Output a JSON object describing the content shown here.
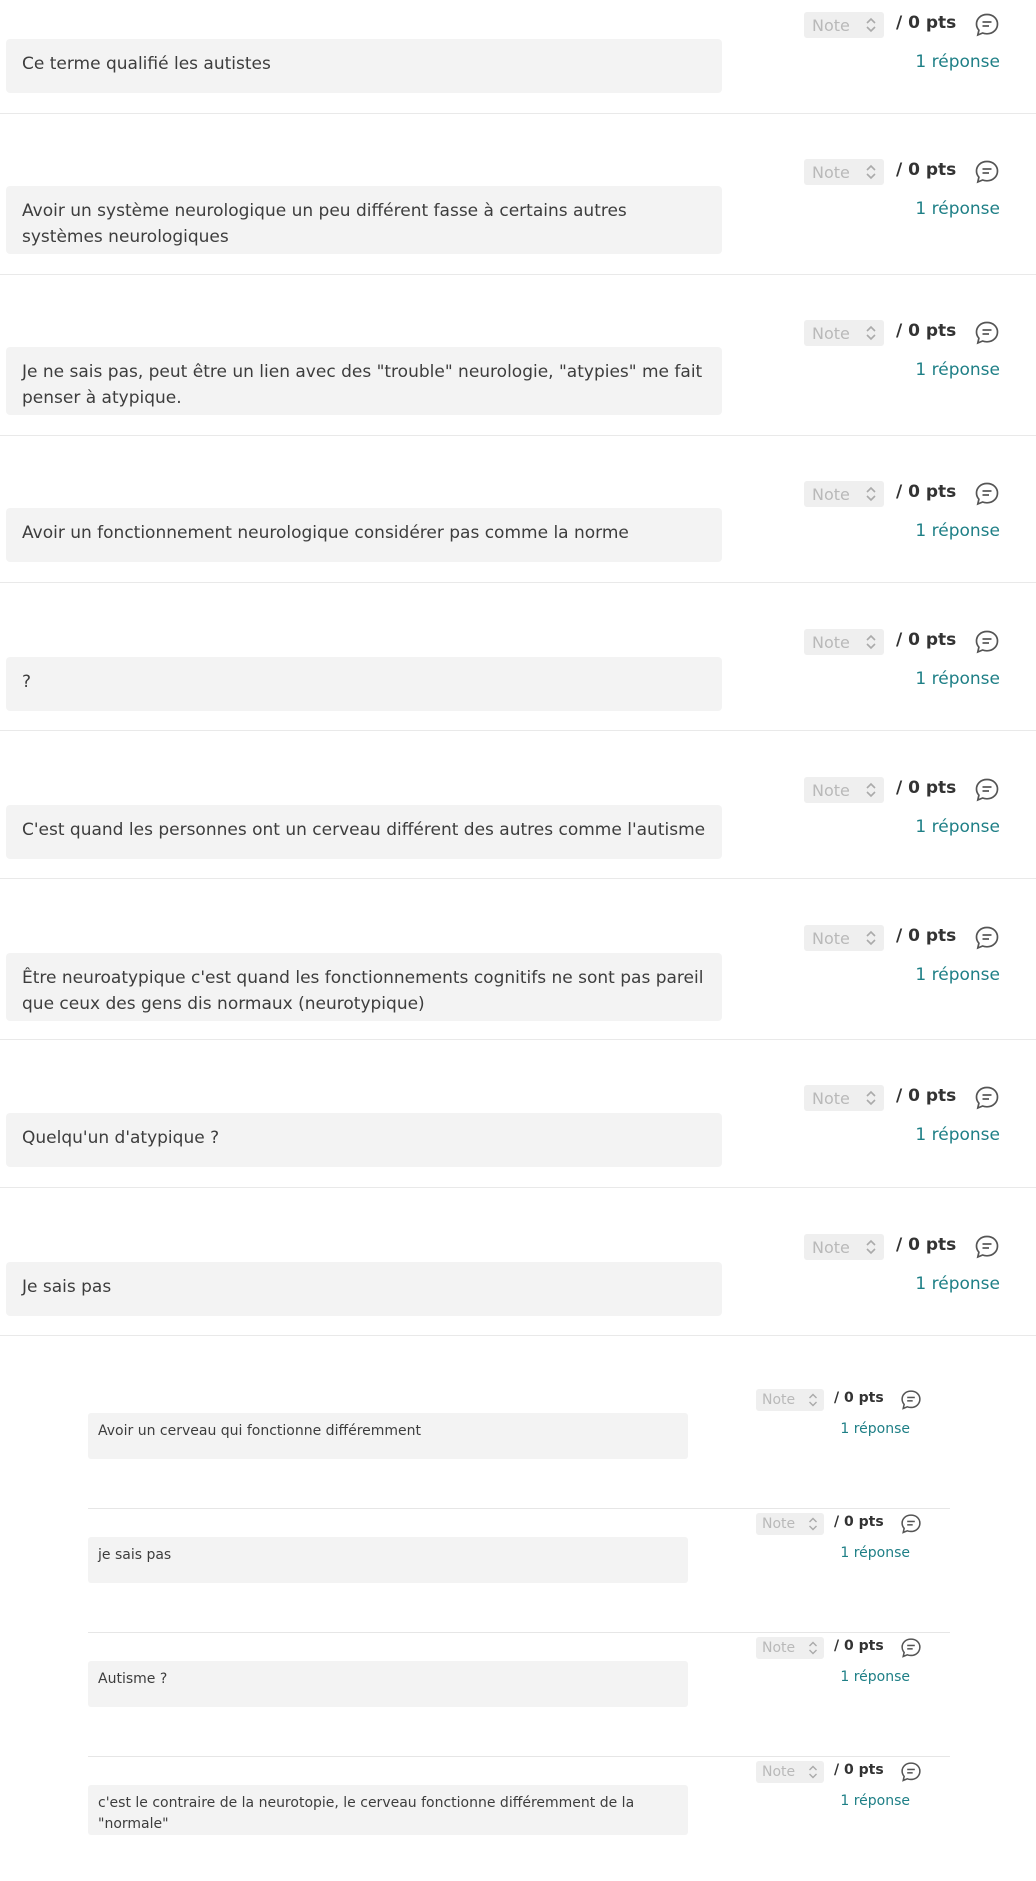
{
  "colors": {
    "accent": "#1e7f86",
    "answer_bg": "#f3f3f3",
    "divider": "#e9e9e9"
  },
  "labels": {
    "note_placeholder": "Note",
    "points": "/ 0 pts",
    "replies": "1 réponse"
  },
  "answers": [
    {
      "text": "Ce terme qualifié les autistes"
    },
    {
      "text": "Avoir un système neurologique un peu différent fasse à certains autres systèmes neurologiques"
    },
    {
      "text": "Je ne sais pas, peut être un lien avec des \"trouble\" neurologie, \"atypies\" me fait penser à atypique."
    },
    {
      "text": "Avoir un fonctionnement neurologique considérer pas comme la norme"
    },
    {
      "text": "?"
    },
    {
      "text": "C'est quand les personnes ont un cerveau différent des autres comme l'autisme"
    },
    {
      "text": "Être neuroatypique c'est quand les fonctionnements cognitifs ne sont pas pareil que ceux des gens dis normaux (neurotypique)"
    },
    {
      "text": "Quelqu'un d'atypique ?"
    },
    {
      "text": "Je sais pas"
    }
  ],
  "nested_answers": [
    {
      "text": "Avoir un cerveau qui fonctionne différemment"
    },
    {
      "text": "je sais pas"
    },
    {
      "text": "Autisme ?"
    },
    {
      "text": "c'est le contraire de la neurotopie, le cerveau fonctionne différemment de la \"normale\""
    }
  ]
}
